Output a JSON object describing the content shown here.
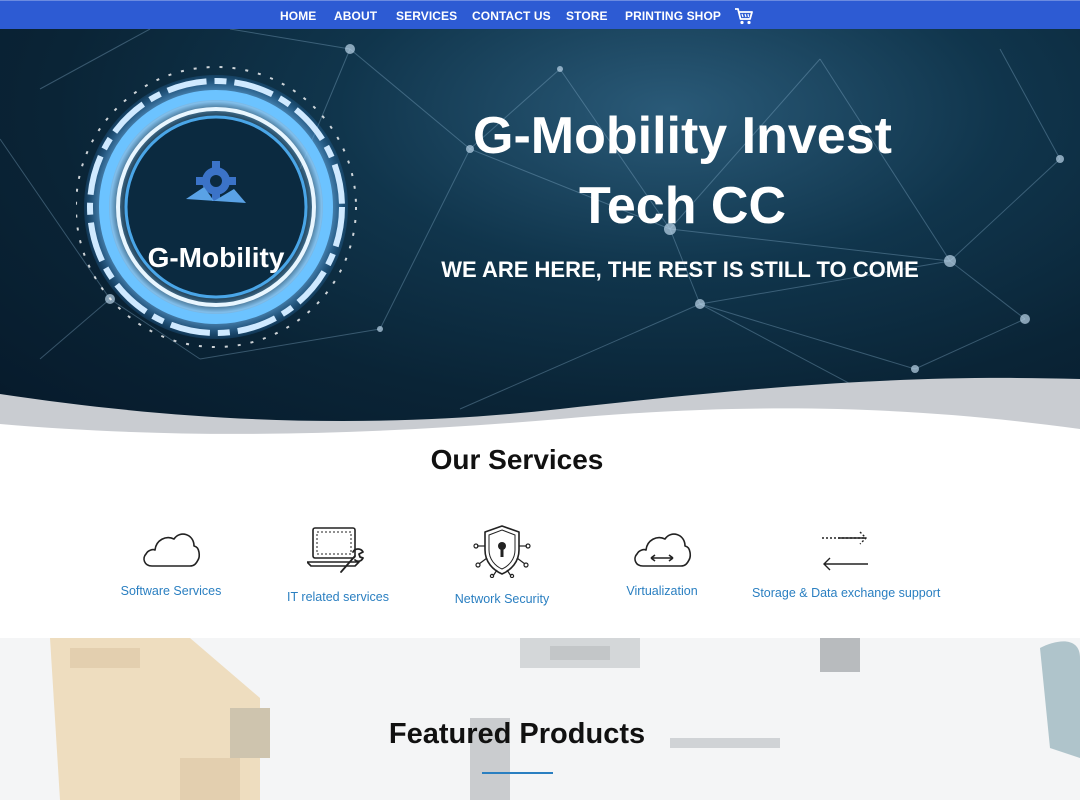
{
  "nav": {
    "items": [
      {
        "label": "HOME"
      },
      {
        "label": "ABOUT"
      },
      {
        "label": "SERVICES"
      },
      {
        "label": "CONTACT US"
      },
      {
        "label": "STORE"
      },
      {
        "label": "PRINTING SHOP"
      }
    ],
    "cart_icon": "shopping-cart-icon"
  },
  "hero": {
    "logo_text": "G-Mobility",
    "title_line1": "G-Mobility Invest",
    "title_line2": "Tech CC",
    "subtitle": "WE ARE HERE, THE REST IS STILL TO COME"
  },
  "services": {
    "title": "Our Services",
    "items": [
      {
        "label": "Software Services",
        "icon": "cloud-icon"
      },
      {
        "label": "IT related services",
        "icon": "laptop-wrench-icon"
      },
      {
        "label": "Network Security",
        "icon": "shield-lock-icon"
      },
      {
        "label": "Virtualization",
        "icon": "cloud-arrows-icon"
      },
      {
        "label": "Storage & Data exchange support",
        "icon": "exchange-arrows-icon"
      }
    ]
  },
  "featured": {
    "title": "Featured Products"
  },
  "colors": {
    "nav_bg": "#2d5bd3",
    "hero_bg": "#0a2436",
    "link": "#2a7fc1"
  }
}
